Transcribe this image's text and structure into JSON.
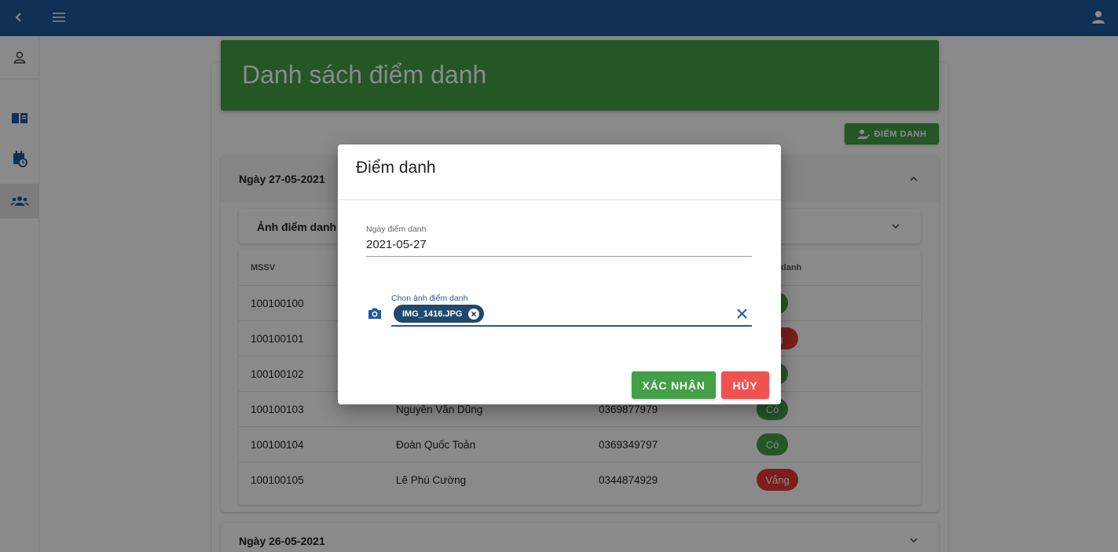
{
  "page": {
    "title": "Danh sách điểm danh",
    "attend_button": "ĐIỂM DANH"
  },
  "sessions": [
    {
      "date": "Ngày 27-05-2021",
      "expanded": true,
      "photo_panel": "Ảnh điểm danh",
      "columns": [
        "MSSV",
        "",
        "",
        "danh"
      ],
      "rows": [
        {
          "mssv": "100100100",
          "name": "",
          "phone": "",
          "status": "Có",
          "status_color": "green"
        },
        {
          "mssv": "100100101",
          "name": "",
          "phone": "",
          "status": "ng",
          "status_color": "red"
        },
        {
          "mssv": "100100102",
          "name": "",
          "phone": "",
          "status": "",
          "status_color": "green"
        },
        {
          "mssv": "100100103",
          "name": "Nguyễn Văn Dũng",
          "phone": "0369877979",
          "status": "Có",
          "status_color": "green"
        },
        {
          "mssv": "100100104",
          "name": "Đoàn Quốc Toản",
          "phone": "0369349797",
          "status": "Có",
          "status_color": "green"
        },
        {
          "mssv": "100100105",
          "name": "Lê Phú Cường",
          "phone": "0344874929",
          "status": "Vắng",
          "status_color": "red"
        }
      ]
    },
    {
      "date": "Ngày 26-05-2021",
      "expanded": false
    }
  ],
  "dialog": {
    "title": "Điểm danh",
    "date_label": "Ngày điểm danh",
    "date_value": "2021-05-27",
    "file_label": "Chọn ảnh điểm danh",
    "file_name": "IMG_1416.JPG",
    "confirm_label": "XÁC NHẬN",
    "cancel_label": "HỦY"
  },
  "colors": {
    "appbar": "#1e5aa0",
    "primary_green": "#43a047",
    "danger_red": "#e53935",
    "chip_dark": "#21486b"
  },
  "icons": {
    "back": "chevron-left-icon",
    "menu": "menu-icon",
    "account": "account-icon",
    "profile": "person-outline-icon",
    "book": "book-icon",
    "calendar": "calendar-clock-icon",
    "group": "group-icon",
    "camera": "camera-icon",
    "close": "close-icon"
  }
}
